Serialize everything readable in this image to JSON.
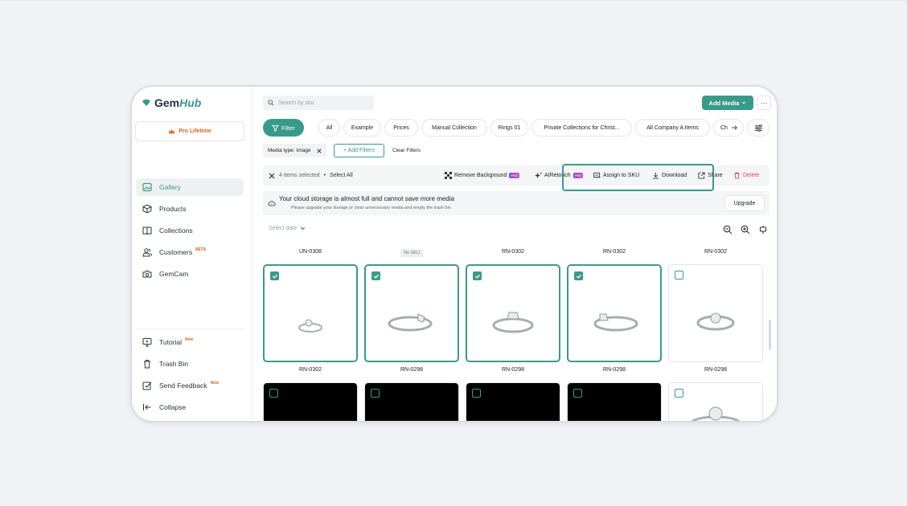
{
  "app": {
    "logo_main": "Gem",
    "logo_accent": "Hub",
    "plan": "Pro Lifetime"
  },
  "sidebar": {
    "items": [
      {
        "label": "Gallery",
        "icon": "image-icon",
        "active": true
      },
      {
        "label": "Products",
        "icon": "box-icon"
      },
      {
        "label": "Collections",
        "icon": "book-icon"
      },
      {
        "label": "Customers",
        "icon": "users-icon",
        "badge": "BETA"
      },
      {
        "label": "GemCam",
        "icon": "camera-icon"
      }
    ],
    "bottom_items": [
      {
        "label": "Tutorial",
        "icon": "presentation-icon",
        "badge": "New"
      },
      {
        "label": "Trash Bin",
        "icon": "trash-icon"
      },
      {
        "label": "Send Feedback",
        "icon": "edit-icon",
        "badge": "New"
      },
      {
        "label": "Collapse",
        "icon": "collapse-icon"
      }
    ]
  },
  "header": {
    "search_placeholder": "Search by sku",
    "add_media": "Add Media",
    "more": "···"
  },
  "filters": {
    "filter_button": "Filter",
    "chips": [
      "All",
      "Example",
      "Prices",
      "Manual Collection",
      "Rings 01",
      "Private Collections for Christ...",
      "All Company A Items",
      "Ch"
    ],
    "active_tag": "Media type: Image",
    "add_filters": "+ Add Filters",
    "clear_filters": "Clear Filters"
  },
  "actions": {
    "selected": "4 items selected",
    "select_all": "Select All",
    "remove_background": "Remove Background",
    "pro_badge": "PRO",
    "airetouch": "AIRetouch",
    "assign_sku": "Assign to SKU",
    "download": "Download",
    "share": "Share",
    "delete": "Delete"
  },
  "storage": {
    "title": "Your cloud storage is almost full and cannot save more media",
    "subtitle": "Please upgrade your storage or clear unnecessary media and empty the trash bin",
    "upgrade": "Upgrade"
  },
  "gallery": {
    "select_date": "Select date",
    "row1_skus": [
      "UN-0308",
      "No SKU",
      "RN-0302",
      "RN-0302",
      "RN-0302"
    ],
    "row1_selected": [
      true,
      true,
      true,
      true,
      false
    ],
    "row2_skus": [
      "RN-0302",
      "RN-0298",
      "RN-0298",
      "RN-0298",
      "RN-0298"
    ]
  },
  "colors": {
    "accent": "#3a9a8a",
    "danger": "#e5484d",
    "pro_badge": "#d8651d"
  }
}
